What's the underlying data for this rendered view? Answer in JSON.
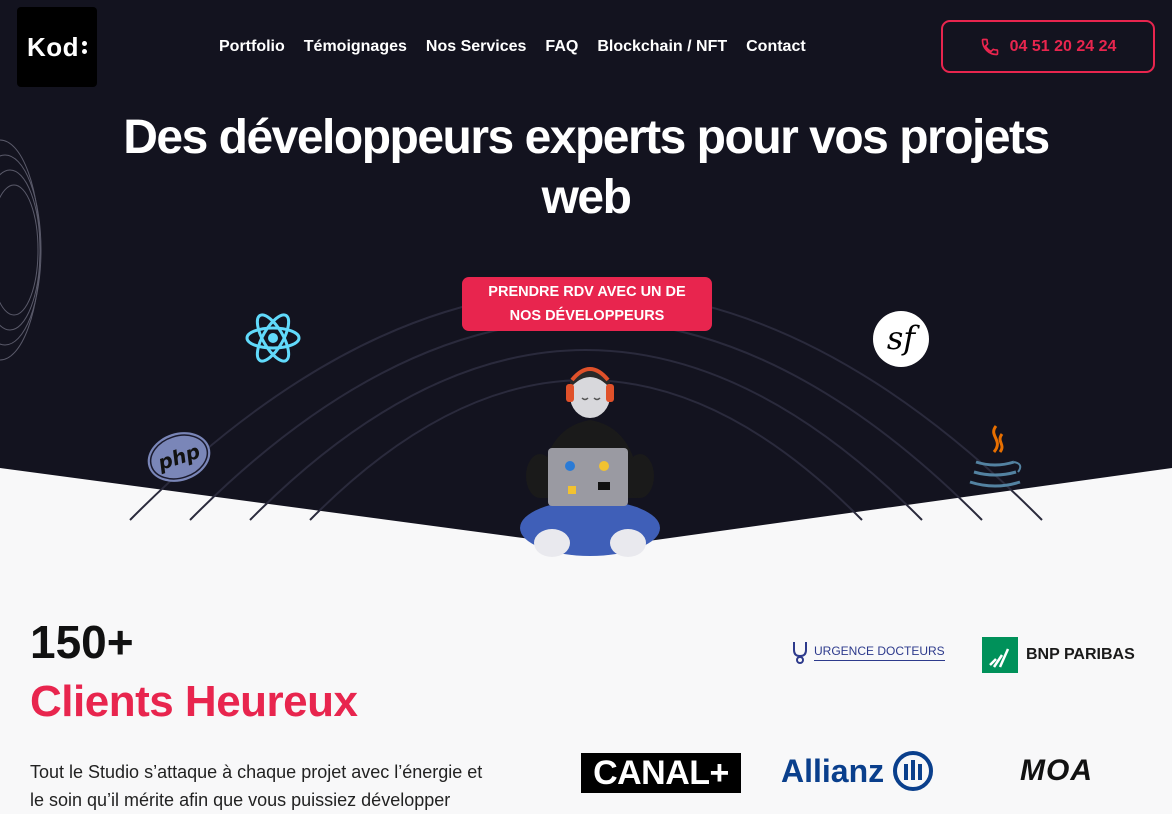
{
  "brand": {
    "logo_text": "Kod"
  },
  "nav": {
    "items": [
      "Portfolio",
      "Témoignages",
      "Nos Services",
      "FAQ",
      "Blockchain / NFT",
      "Contact"
    ]
  },
  "phone": {
    "label": "04 51 20 24 24"
  },
  "hero": {
    "title_line1": "Des développeurs  experts pour vos projets",
    "title_line2": "web",
    "cta_line1": "PRENDRE RDV AVEC UN DE",
    "cta_line2": "NOS DÉVELOPPEURS"
  },
  "tech_icons": {
    "php_label": "php"
  },
  "stats": {
    "number": "150+",
    "label": "Clients Heureux",
    "desc_line1": "Tout le Studio s’attaque à chaque projet avec l’énergie et",
    "desc_line2": "le soin qu’il mérite afin que vous puissiez développer"
  },
  "clients": {
    "urgence": "URGENCE DOCTEURS",
    "bnp": "BNP PARIBAS",
    "canal": "CANAL+",
    "allianz": "Allianz",
    "moa": "MOA"
  },
  "colors": {
    "accent": "#e8254e",
    "hero_bg": "#13131f",
    "page_bg": "#f8f8f9"
  }
}
